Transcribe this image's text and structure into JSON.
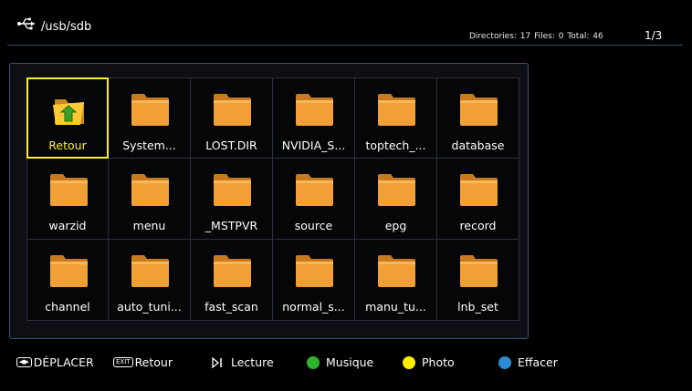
{
  "header": {
    "usb_icon": "usb-icon",
    "path": "/usb/sdb",
    "stats": "Directories: 17   Files: 0   Total: 46",
    "page": "1/3"
  },
  "grid": {
    "items": [
      {
        "label": "Retour",
        "icon": "back-folder-icon",
        "selected": true
      },
      {
        "label": "System...",
        "icon": "folder-icon"
      },
      {
        "label": "LOST.DIR",
        "icon": "folder-icon"
      },
      {
        "label": "NVIDIA_S...",
        "icon": "folder-icon"
      },
      {
        "label": "toptech_...",
        "icon": "folder-icon"
      },
      {
        "label": "database",
        "icon": "folder-icon"
      },
      {
        "label": "warzid",
        "icon": "folder-icon"
      },
      {
        "label": "menu",
        "icon": "folder-icon"
      },
      {
        "label": "_MSTPVR",
        "icon": "folder-icon"
      },
      {
        "label": "source",
        "icon": "folder-icon"
      },
      {
        "label": "epg",
        "icon": "folder-icon"
      },
      {
        "label": "record",
        "icon": "folder-icon"
      },
      {
        "label": "channel",
        "icon": "folder-icon"
      },
      {
        "label": "auto_tuni...",
        "icon": "folder-icon"
      },
      {
        "label": "fast_scan",
        "icon": "folder-icon"
      },
      {
        "label": "normal_s...",
        "icon": "folder-icon"
      },
      {
        "label": "manu_tu...",
        "icon": "folder-icon"
      },
      {
        "label": "lnb_set",
        "icon": "folder-icon"
      }
    ]
  },
  "footer": {
    "move_key": "◀▶",
    "move_label": "DÉPLACER",
    "exit_key": "EXIT",
    "exit_label": "Retour",
    "play_icon": "play-pause-icon",
    "play_label": "Lecture",
    "green_label": "Musique",
    "yellow_label": "Photo",
    "blue_label": "Effacer",
    "colors": {
      "green": "#2db52a",
      "yellow": "#ffee00",
      "blue": "#2a8ad4",
      "folder": "#f2a036",
      "highlight": "#ffef2a"
    }
  }
}
